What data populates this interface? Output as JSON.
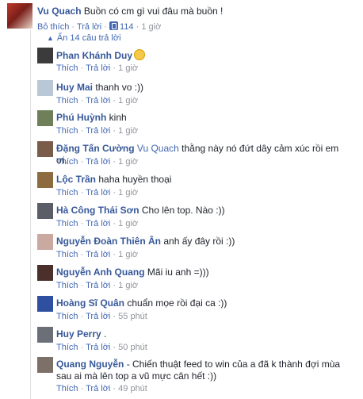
{
  "top_comment": {
    "author": "Vu Quach",
    "text": "Buồn có cm gì vui đâu mà buồn !",
    "unlike": "Bỏ thích",
    "reply": "Trả lời",
    "likes": "114",
    "time": "1 giờ"
  },
  "hide_replies": "Ẩn 14 câu trả lời",
  "action_like": "Thích",
  "action_reply": "Trả lời",
  "dot": "·",
  "replies": [
    {
      "author": "Phan Khánh Duy",
      "mention": "",
      "text": "",
      "time": "1 giờ",
      "avatar_color": "#3b3b3b"
    },
    {
      "author": "Huy Mai",
      "mention": "",
      "text": "thanh vo :))",
      "time": "1 giờ",
      "avatar_color": "#b9c7d6"
    },
    {
      "author": "Phú Huỳnh",
      "mention": "",
      "text": "kinh",
      "time": "1 giờ",
      "avatar_color": "#6e7f5a"
    },
    {
      "author": "Đặng Tấn Cường",
      "mention": "Vu Quach",
      "text": "thằng này nó đứt dây cảm xúc rồi em ơi.",
      "time": "1 giờ",
      "avatar_color": "#7a5c4a"
    },
    {
      "author": "Lộc Trần",
      "mention": "",
      "text": "haha huyền thoại",
      "time": "1 giờ",
      "avatar_color": "#8c6b3e"
    },
    {
      "author": "Hà Công Thái Sơn",
      "mention": "",
      "text": "Cho lên top. Nào :))",
      "time": "1 giờ",
      "avatar_color": "#5b5e66"
    },
    {
      "author": "Nguyễn Đoàn Thiên Ân",
      "mention": "",
      "text": "anh ấy đây rồi :))",
      "time": "1 giờ",
      "avatar_color": "#c9a9a0"
    },
    {
      "author": "Nguyễn Anh Quang",
      "mention": "",
      "text": "Mãi iu anh =)))",
      "time": "1 giờ",
      "avatar_color": "#4a2f2a"
    },
    {
      "author": "Hoàng Sĩ Quân",
      "mention": "",
      "text": "chuẩn mọe rồi đại ca :))",
      "time": "55 phút",
      "avatar_color": "#2f4fa0"
    },
    {
      "author": "Huy Perry",
      "mention": "",
      "text": ".",
      "time": "50 phút",
      "avatar_color": "#6a6f78"
    },
    {
      "author": "Quang Nguyễn",
      "mention": "",
      "text": "- Chiến thuật feed to win của a đã k thành đợi mùa sau ai mà lên top a vũ mực cân hết :))",
      "time": "49 phút",
      "avatar_color": "#7d7068"
    }
  ]
}
